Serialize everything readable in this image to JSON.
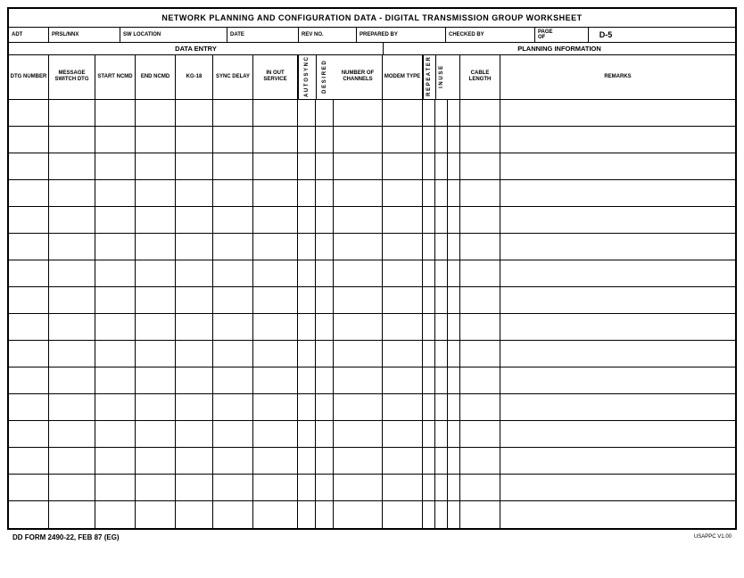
{
  "title": "NETWORK PLANNING AND CONFIGURATION DATA - DIGITAL TRANSMISSION GROUP WORKSHEET",
  "header": {
    "adt_label": "ADT",
    "prsl_label": "PRSL/NNX",
    "sw_location_label": "SW LOCATION",
    "date_label": "DATE",
    "rev_no_label": "REV NO.",
    "prepared_by_label": "PREPARED BY",
    "checked_by_label": "CHECKED BY",
    "page_label": "PAGE",
    "of_label": "OF",
    "form_number": "D-5"
  },
  "section_labels": {
    "data_entry": "DATA ENTRY",
    "planning_info": "PLANNING INFORMATION"
  },
  "columns": {
    "dtg_number": "DTG NUMBER",
    "message_switch_dtg": "MESSAGE SWITCH DTG",
    "start_ncmd": "START NCMD",
    "end_ncmd": "END NCMD",
    "kg18": "KG-18",
    "sync_delay": "SYNC DELAY",
    "in_out_service": "IN OUT SERVICE",
    "auto_sync": "A U T O S Y N C",
    "desired": "D E S I R E D",
    "number_of_channels": "NUMBER OF CHANNELS",
    "modem_type": "MODEM TYPE",
    "repeater": "R E P E A T E R",
    "in_use": "I N U S E",
    "cable_length": "CABLE LENGTH",
    "remarks": "REMARKS"
  },
  "data_rows": 16,
  "footer": {
    "form_id": "DD FORM 2490-22, FEB 87 (EG)",
    "usappc": "USAPPC V1.00"
  }
}
